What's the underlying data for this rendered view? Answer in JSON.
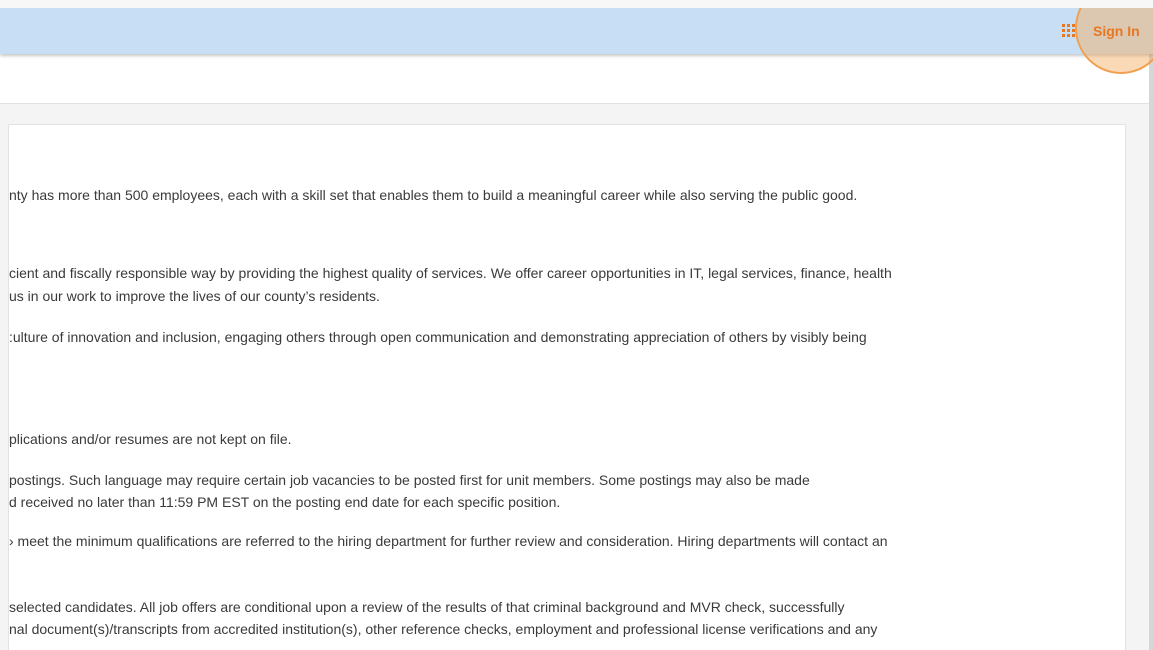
{
  "header": {
    "apps_icon": "apps-grid-icon",
    "signin_label": "Sign In",
    "accent_color": "#e87722",
    "bar_color": "#c8def5"
  },
  "content": {
    "lines": [
      "nty has more than 500 employees, each with a skill set that enables them to build a meaningful career while also serving the public good.",
      "cient and fiscally responsible way by providing the highest quality of services.  We offer career opportunities in IT, legal services, finance, health",
      "us in our work to improve the lives of our county’s residents.",
      ":ulture of innovation and inclusion, engaging others through open communication and demonstrating appreciation of others by visibly being",
      "plications and/or resumes are not kept on file.",
      "postings.  Such language may require certain job vacancies to be posted first for unit members.  Some postings may also be made",
      "d received no later than 11:59 PM EST on the posting end date for each specific position.",
      "› meet the minimum qualifications are referred to the hiring department for further review and consideration. Hiring departments will contact an",
      " selected candidates. All job offers are conditional upon a review of the results of that criminal background and MVR check, successfully",
      "nal document(s)/transcripts from accredited institution(s), other reference checks, employment and professional license verifications and any"
    ]
  }
}
